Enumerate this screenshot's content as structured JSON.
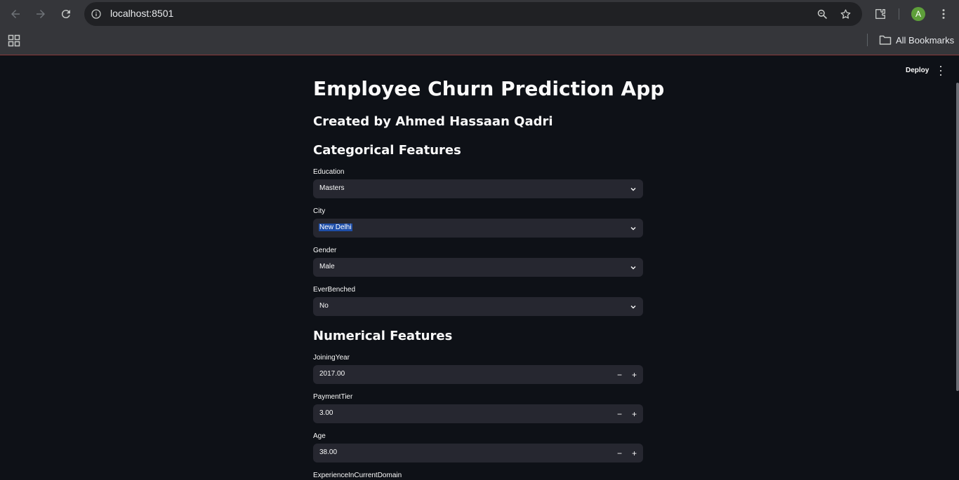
{
  "browser": {
    "url": "localhost:8501",
    "bookmarks_label": "All Bookmarks",
    "profile_initial": "A",
    "profile_color": "#5e9f3a"
  },
  "app": {
    "deploy_label": "Deploy",
    "title": "Employee Churn Prediction App",
    "subtitle": "Created by Ahmed Hassaan Qadri",
    "categorical_header": "Categorical Features",
    "numerical_header": "Numerical Features",
    "categorical": [
      {
        "label": "Education",
        "value": "Masters"
      },
      {
        "label": "City",
        "value": "New Delhi"
      },
      {
        "label": "Gender",
        "value": "Male"
      },
      {
        "label": "EverBenched",
        "value": "No"
      }
    ],
    "numerical": [
      {
        "label": "JoiningYear",
        "value": "2017.00"
      },
      {
        "label": "PaymentTier",
        "value": "3.00"
      },
      {
        "label": "Age",
        "value": "38.00"
      },
      {
        "label": "ExperienceInCurrentDomain"
      }
    ],
    "minus_symbol": "−",
    "plus_symbol": "+"
  },
  "colors": {
    "background": "#0e1117",
    "widget": "#262730",
    "text": "#fafafa",
    "selection": "#1e4ea8"
  }
}
